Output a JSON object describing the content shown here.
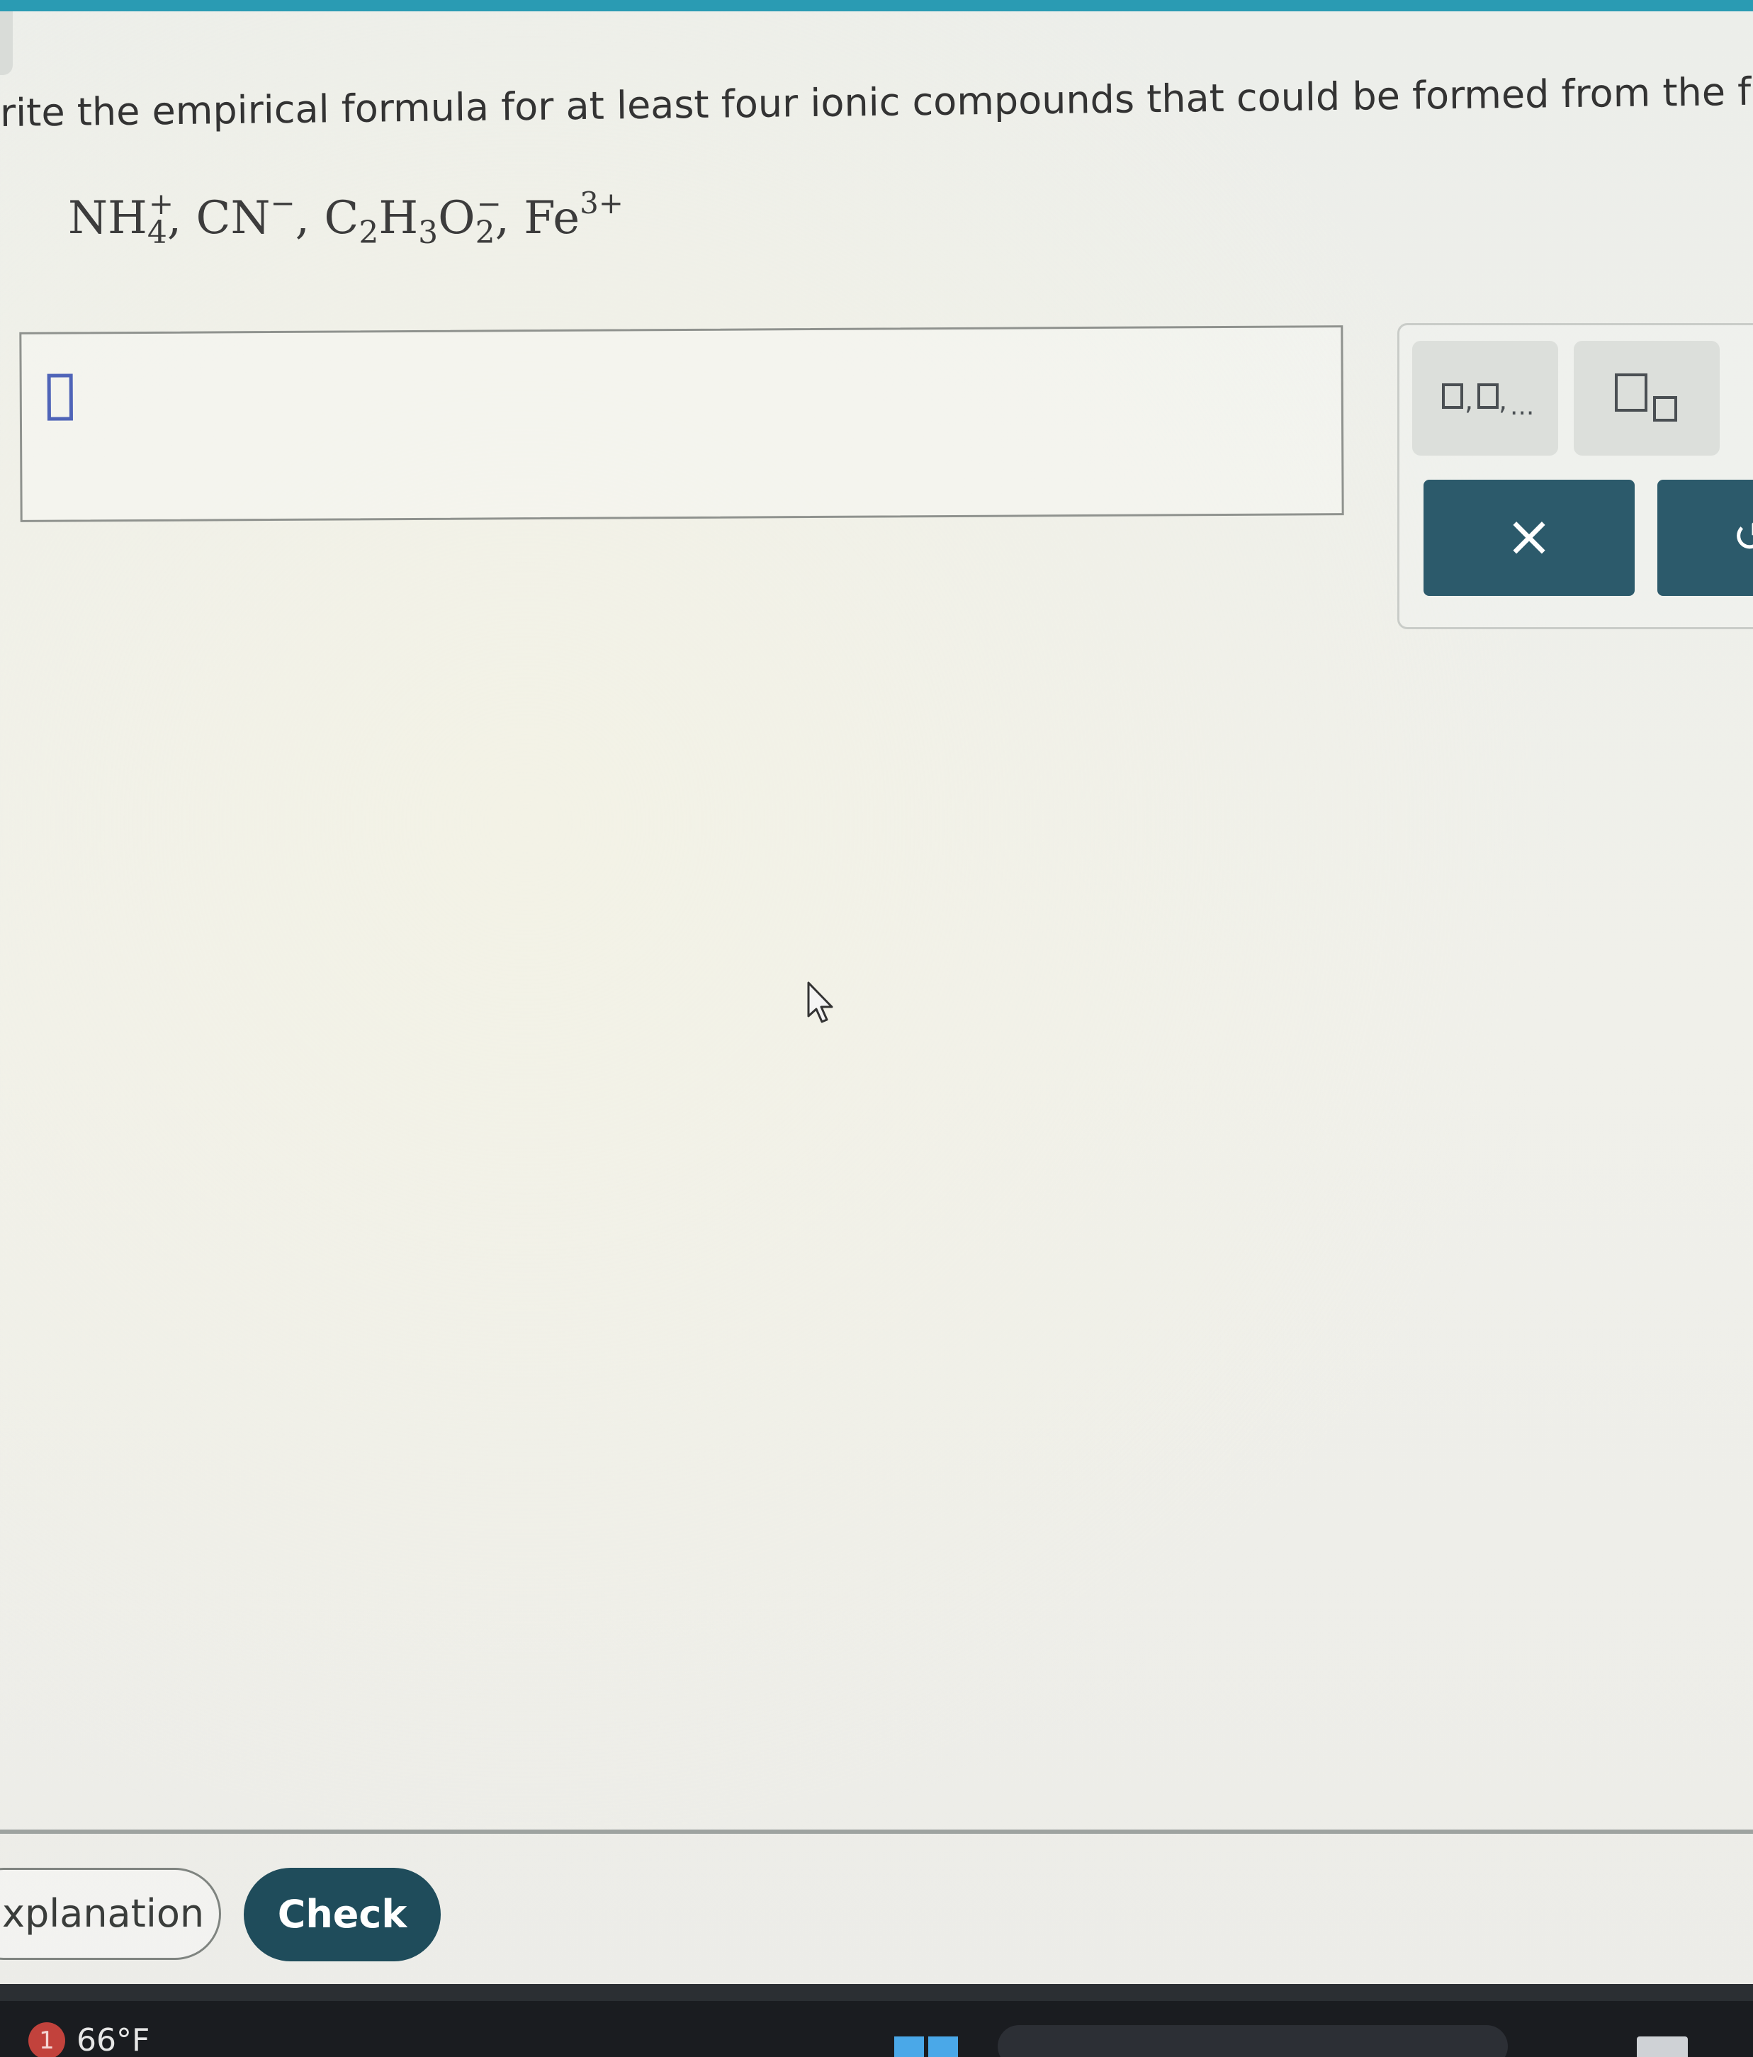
{
  "question": {
    "text": "rite the empirical formula for at least four ionic compounds that could be formed from the foll"
  },
  "ions": {
    "nh4": {
      "base": "NH",
      "sub": "4",
      "sup": "+"
    },
    "cn": {
      "base": "CN",
      "sup": "−"
    },
    "c2h3o2": {
      "c": "C",
      "c_sub": "2",
      "h": "H",
      "h_sub": "3",
      "o": "O",
      "o_sub": "2",
      "sup": "−"
    },
    "fe": {
      "base": "Fe",
      "sup": "3+"
    },
    "separator": ", "
  },
  "toolbar": {
    "list_label": ",",
    "list_dots": "...",
    "clear_symbol": "×",
    "next_symbol": "↺"
  },
  "footer": {
    "explanation_label": "xplanation",
    "check_label": "Check"
  },
  "taskbar": {
    "notification_count": "1",
    "temperature": "66°F"
  },
  "colors": {
    "accent_bar": "#2a9bb3",
    "button_dark": "#2c5a6b",
    "check_button": "#1f4c5b"
  }
}
